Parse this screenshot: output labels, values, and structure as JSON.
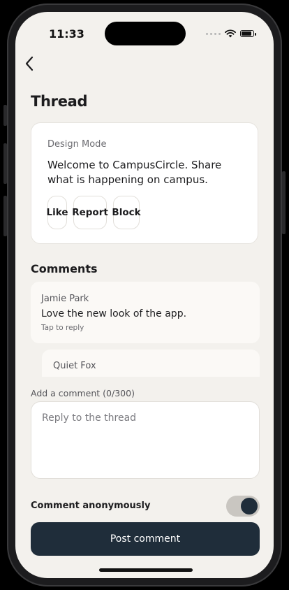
{
  "status": {
    "time": "11:33"
  },
  "header": {
    "title": "Thread",
    "back_icon": "chevron-left-icon"
  },
  "post": {
    "mode": "Design Mode",
    "body": "Welcome to CampusCircle. Share what is happening on campus.",
    "actions": {
      "like": "Like",
      "report": "Report",
      "block": "Block"
    }
  },
  "comments": {
    "title": "Comments",
    "items": [
      {
        "author": "Jamie Park",
        "text": "Love the new look of the app.",
        "reply_hint": "Tap to reply"
      },
      {
        "author": "Quiet Fox"
      }
    ]
  },
  "composer": {
    "label": "Add a comment (0/300)",
    "placeholder": "Reply to the thread",
    "value": "",
    "anonymous_label": "Comment anonymously",
    "anonymous_enabled": true,
    "submit_label": "Post comment"
  },
  "colors": {
    "background": "#f3f1ed",
    "primary": "#1f2d3a",
    "card": "#ffffff"
  }
}
